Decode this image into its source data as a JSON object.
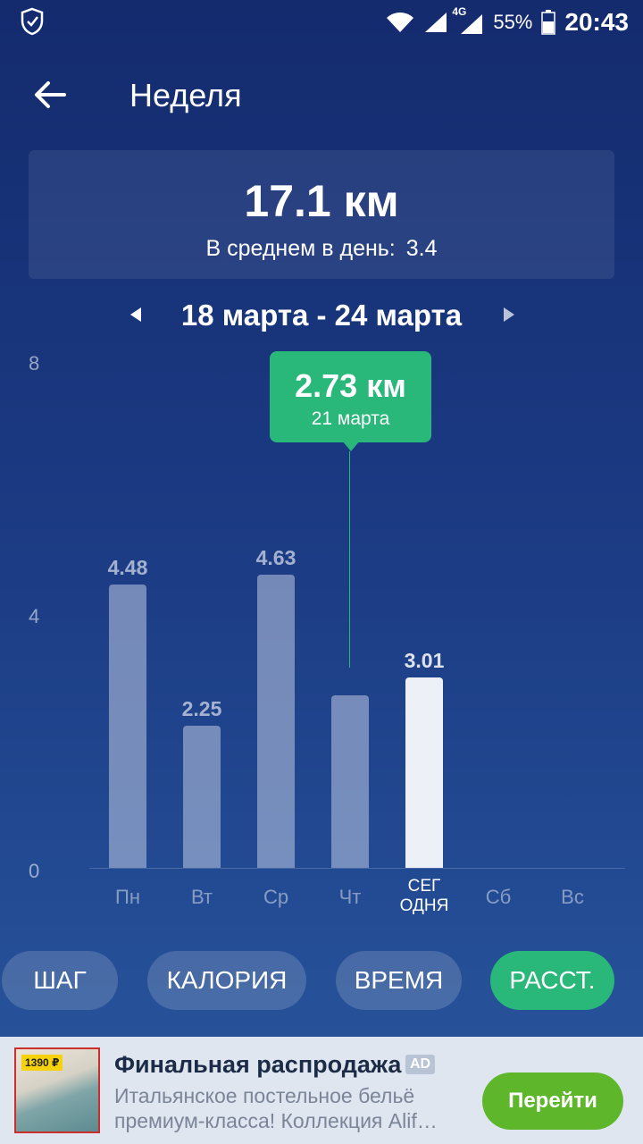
{
  "status_bar": {
    "network": "4G",
    "battery": "55%",
    "time": "20:43",
    "icons": [
      "shield-icon",
      "wifi-icon",
      "signal-icon",
      "signal-4g-icon",
      "battery-icon"
    ]
  },
  "app_bar": {
    "back_icon": "arrow-left-icon",
    "title": "Неделя"
  },
  "summary": {
    "total": "17.1 км",
    "average_label": "В среднем в день:",
    "average_value": "3.4"
  },
  "date_range": {
    "label": "18 марта - 24 марта",
    "prev_icon": "triangle-left-icon",
    "next_icon": "triangle-right-icon"
  },
  "chart_data": {
    "type": "bar",
    "categories": [
      "Пн",
      "Вт",
      "Ср",
      "Чт",
      "СЕГ ОДНЯ",
      "Сб",
      "Вс"
    ],
    "values": [
      4.48,
      2.25,
      4.63,
      2.73,
      3.01,
      null,
      null
    ],
    "value_labels": [
      "4.48",
      "2.25",
      "4.63",
      "",
      "3.01",
      "",
      ""
    ],
    "y_ticks": [
      "8",
      "4",
      "0"
    ],
    "ylim": [
      0,
      8
    ],
    "highlight_index": 4,
    "selected_index": 3,
    "tooltip": {
      "value": "2.73 км",
      "date": "21 марта"
    },
    "colors": {
      "bar": "#8a9bbf",
      "today": "#eef0f8",
      "tooltip": "#2ab77a"
    }
  },
  "metric_tabs": [
    {
      "label": "ШАГ",
      "active": false
    },
    {
      "label": "КАЛОРИЯ",
      "active": false
    },
    {
      "label": "ВРЕМЯ",
      "active": false
    },
    {
      "label": "РАССТ.",
      "active": true
    }
  ],
  "ad": {
    "title": "Финальная распродажа",
    "badge": "AD",
    "description": "Итальянское постельное бельё премиум-класса! Коллекция Alif…",
    "cta": "Перейти",
    "thumb_price": "1390 ₽"
  }
}
